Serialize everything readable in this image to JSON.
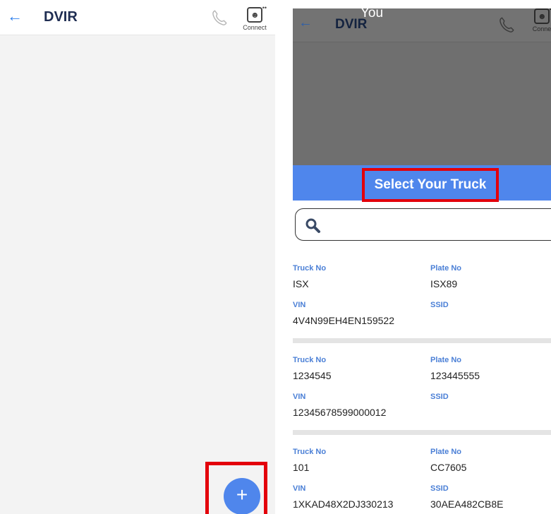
{
  "left": {
    "header": {
      "back_icon": "back-arrow-icon",
      "title": "DVIR",
      "phone_icon": "phone-icon",
      "connect_label": "Connect"
    },
    "fab_label": "+"
  },
  "right": {
    "overlay_text": "You",
    "header": {
      "back_icon": "back-arrow-icon",
      "title": "DVIR",
      "connect_label": "Conne"
    },
    "select_title": "Select Your Truck",
    "search": {
      "placeholder": "",
      "icon": "search-icon"
    },
    "field_labels": {
      "truck_no": "Truck No",
      "plate_no": "Plate No",
      "vin": "VIN",
      "ssid": "SSID"
    },
    "trucks": [
      {
        "truck_no": "ISX",
        "plate_no": "ISX89",
        "vin": "4V4N99EH4EN159522",
        "ssid": ""
      },
      {
        "truck_no": "1234545",
        "plate_no": "123445555",
        "vin": "12345678599000012",
        "ssid": ""
      },
      {
        "truck_no": "101",
        "plate_no": "CC7605",
        "vin": "1XKAD48X2DJ330213",
        "ssid": "30AEA482CB8E"
      }
    ]
  },
  "colors": {
    "accent_blue": "#4f86ec",
    "highlight_red": "#e3000b",
    "label_blue": "#4a7fd6"
  }
}
